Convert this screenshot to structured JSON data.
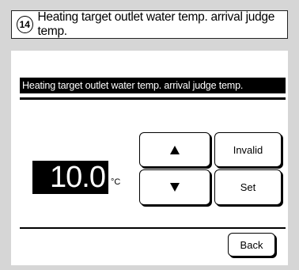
{
  "title": {
    "number": "14",
    "text": "Heating target outlet water temp. arrival judge temp."
  },
  "screen": {
    "header": "Heating target outlet water temp. arrival judge temp.",
    "value": "10.0",
    "unit": "°C",
    "buttons": {
      "up_icon": "triangle-up",
      "down_icon": "triangle-down",
      "invalid_label": "Invalid",
      "set_label": "Set",
      "back_label": "Back"
    }
  }
}
